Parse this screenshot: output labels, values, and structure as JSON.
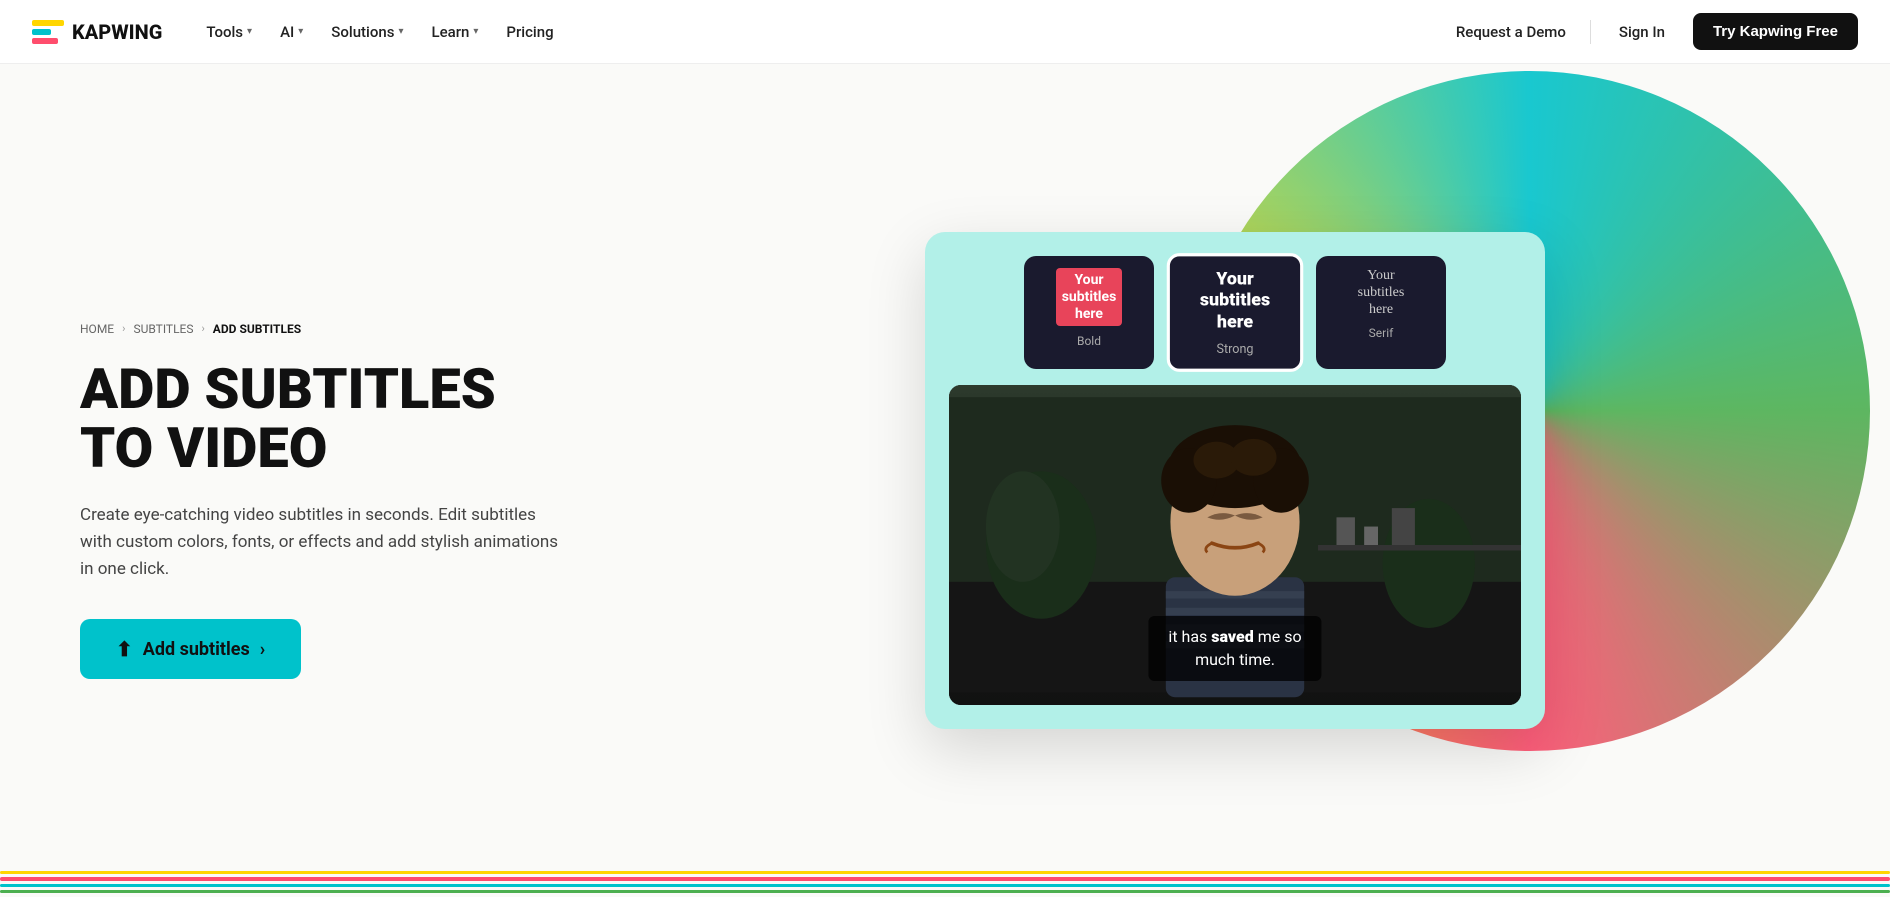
{
  "nav": {
    "logo_text": "KAPWING",
    "items": [
      {
        "label": "Tools",
        "has_dropdown": true
      },
      {
        "label": "AI",
        "has_dropdown": true
      },
      {
        "label": "Solutions",
        "has_dropdown": true
      },
      {
        "label": "Learn",
        "has_dropdown": true
      },
      {
        "label": "Pricing",
        "has_dropdown": false
      }
    ],
    "request_demo": "Request a Demo",
    "sign_in": "Sign In",
    "try_free": "Try Kapwing Free"
  },
  "breadcrumb": {
    "home": "HOME",
    "subtitles": "SUBTITLES",
    "current": "ADD SUBTITLES"
  },
  "hero": {
    "title_line1": "ADD SUBTITLES",
    "title_line2": "TO VIDEO",
    "description": "Create eye-catching video subtitles in seconds. Edit subtitles with custom colors, fonts, or effects and add stylish animations in one click.",
    "cta": "Add subtitles"
  },
  "presets": [
    {
      "id": "bold",
      "label": "Bold",
      "subtitle": "Your subtitles here",
      "style": "bold"
    },
    {
      "id": "strong",
      "label": "Strong",
      "subtitle": "Your subtitles here",
      "style": "strong"
    },
    {
      "id": "serif",
      "label": "Serif",
      "subtitle": "Your subtitles here",
      "style": "serif"
    }
  ],
  "video": {
    "subtitle_normal": "it has ",
    "subtitle_bold": "saved",
    "subtitle_normal2": " me so",
    "subtitle_line2": "much time."
  },
  "colors": {
    "teal": "#00C2CB",
    "red": "#FF4D6D",
    "yellow": "#FFD600",
    "green": "#4CAF50",
    "dark": "#111111",
    "line1": "#FFD600",
    "line2": "#FF4D6D",
    "line3": "#00C2CB",
    "line4": "#4CAF50"
  }
}
